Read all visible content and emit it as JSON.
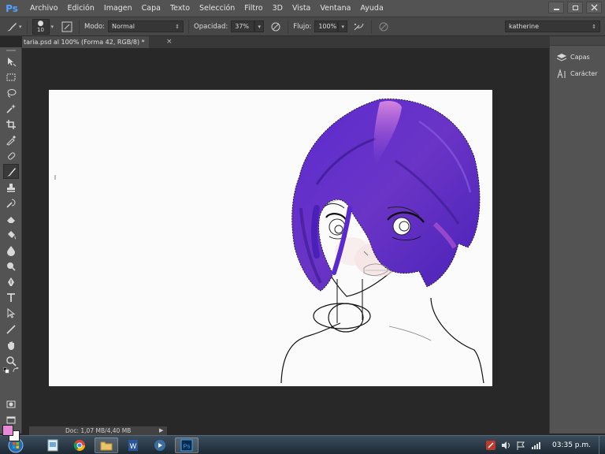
{
  "app": {
    "logo": "Ps",
    "menu": [
      "Archivo",
      "Edición",
      "Imagen",
      "Capa",
      "Texto",
      "Selección",
      "Filtro",
      "3D",
      "Vista",
      "Ventana",
      "Ayuda"
    ],
    "window_buttons": [
      "minimize",
      "restore",
      "close"
    ]
  },
  "options": {
    "brush_size": "10",
    "mode_label": "Modo:",
    "mode_value": "Normal",
    "opacity_label": "Opacidad:",
    "opacity_value": "37%",
    "flow_label": "Flujo:",
    "flow_value": "100%",
    "workspace": "katherine"
  },
  "document": {
    "tab_title": "taria.psd al 100% (Forma 42, RGB/8) *",
    "tab_close": "×"
  },
  "status": {
    "zoom": "",
    "doc_info": "Doc: 1,07 MB/4,40 MB",
    "arrow": "▶"
  },
  "panels": [
    {
      "label": "Capas",
      "icon": "layers-icon"
    },
    {
      "label": "Carácter",
      "icon": "character-icon"
    }
  ],
  "colors": {
    "foreground": "#e889d7",
    "background": "#ffffff"
  },
  "tools": [
    "move-tool-icon",
    "marquee-tool-icon",
    "lasso-tool-icon",
    "magic-wand-tool-icon",
    "crop-tool-icon",
    "eyedropper-tool-icon",
    "healing-brush-tool-icon",
    "brush-tool-icon",
    "clone-stamp-tool-icon",
    "history-brush-tool-icon",
    "eraser-tool-icon",
    "paint-bucket-tool-icon",
    "blur-tool-icon",
    "dodge-tool-icon",
    "pen-tool-icon",
    "type-tool-icon",
    "path-selection-tool-icon",
    "line-tool-icon",
    "hand-tool-icon",
    "zoom-tool-icon"
  ],
  "taskbar": {
    "apps": [
      "start-orb-icon",
      "paint-app-icon",
      "chrome-app-icon",
      "explorer-app-icon",
      "word-app-icon",
      "media-app-icon",
      "photoshop-app-icon"
    ],
    "clock": "03:35 p.m."
  }
}
